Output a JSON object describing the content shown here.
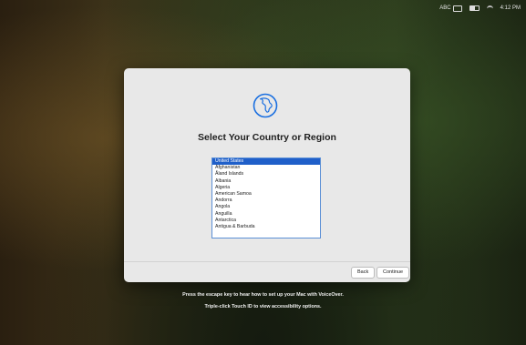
{
  "menubar": {
    "input_source": "ABC",
    "time": "4:12 PM"
  },
  "window": {
    "title": "Select Your Country or Region",
    "countries": [
      "United States",
      "Afghanistan",
      "Åland Islands",
      "Albania",
      "Algeria",
      "American Samoa",
      "Andorra",
      "Angola",
      "Anguilla",
      "Antarctica",
      "Antigua & Barbuda"
    ],
    "selected_country": "United States",
    "back_label": "Back",
    "continue_label": "Continue"
  },
  "hints": {
    "voiceover": "Press the escape key to hear how to set up your Mac with VoiceOver.",
    "accessibility": "Triple-click Touch ID to view accessibility options."
  },
  "icons": {
    "globe": "globe-icon",
    "keyboard": "keyboard-icon",
    "battery": "battery-icon",
    "wifi": "wifi-icon"
  },
  "colors": {
    "selection": "#1f5fc9",
    "globe_blue": "#1a6fe0",
    "window_bg": "#e8e8e8"
  }
}
